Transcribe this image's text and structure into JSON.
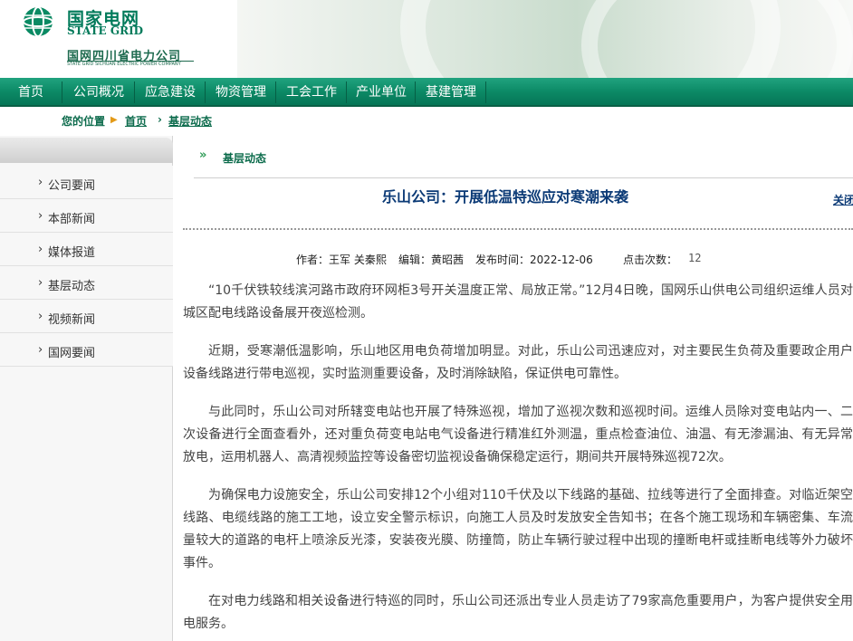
{
  "header": {
    "brand_cn": "国家电网",
    "brand_en": "STATE GRID",
    "company_cn": "国网四川省电力公司",
    "company_en": "STATE GRID SICHUAN ELECTRIC POWER COMPANY",
    "logo_icon": "state-grid-globe-icon",
    "brand_color": "#007a5a"
  },
  "nav": {
    "items": [
      "首页",
      "公司概况",
      "应急建设",
      "物资管理",
      "工会工作",
      "产业单位",
      "基建管理"
    ],
    "bar_color": "#0c8a66"
  },
  "breadcrumb": {
    "prefix": "您的位置",
    "sep_icon": "▶",
    "home": "首页",
    "sep2": "›",
    "current": "基层动态"
  },
  "sidebar": {
    "chevron": "›",
    "items": [
      "公司要闻",
      "本部新闻",
      "媒体报道",
      "基层动态",
      "视频新闻",
      "国网要闻"
    ]
  },
  "article": {
    "section": "基层动态",
    "section_icon": "»",
    "title": "乐山公司：开展低温特巡应对寒潮来袭",
    "close_label": "关闭",
    "author": "作者：王军 关秦熙",
    "editor": "编辑：黄昭茜",
    "publish_time": "发布时间：2022-12-06",
    "clicks_label": "点击次数：",
    "clicks": "12",
    "paragraphs": [
      "“10千伏铁较线滨河路市政府环网柜3号开关温度正常、局放正常。”12月4日晚，国网乐山供电公司组织运维人员对城区配电线路设备展开夜巡检测。",
      "近期，受寒潮低温影响，乐山地区用电负荷增加明显。对此，乐山公司迅速应对，对主要民生负荷及重要政企用户设备线路进行带电巡视，实时监测重要设备，及时消除缺陷，保证供电可靠性。",
      "与此同时，乐山公司对所辖变电站也开展了特殊巡视，增加了巡视次数和巡视时间。运维人员除对变电站内一、二次设备进行全面查看外，还对重负荷变电站电气设备进行精准红外测温，重点检查油位、油温、有无渗漏油、有无异常放电，运用机器人、高清视频监控等设备密切监视设备确保稳定运行，期间共开展特殊巡视72次。",
      "为确保电力设施安全，乐山公司安排12个小组对110千伏及以下线路的基础、拉线等进行了全面排查。对临近架空线路、电缆线路的施工工地，设立安全警示标识，向施工人员及时发放安全告知书；在各个施工现场和车辆密集、车流量较大的道路的电杆上喷涂反光漆，安装夜光膜、防撞筒，防止车辆行驶过程中出现的撞断电杆或挂断电线等外力破坏事件。",
      "在对电力线路和相关设备进行特巡的同时，乐山公司还派出专业人员走访了79家高危重要用户，为客户提供安全用电服务。"
    ]
  }
}
